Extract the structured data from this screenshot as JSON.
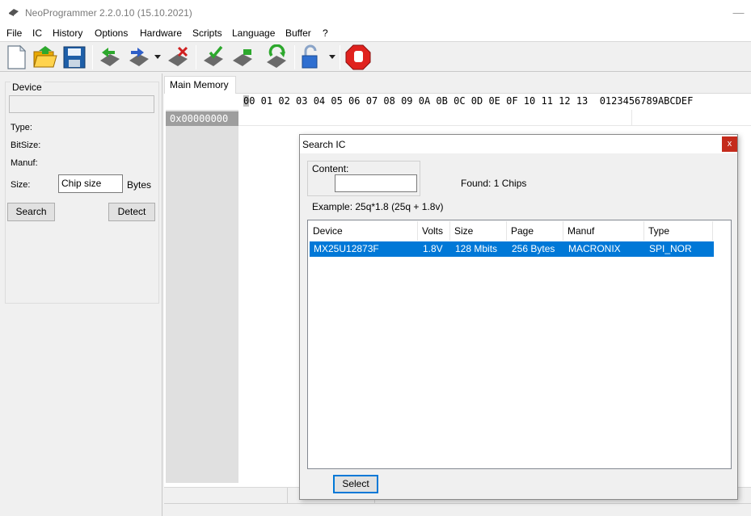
{
  "window": {
    "title": "NeoProgrammer 2.2.0.10 (15.10.2021)",
    "minimize_glyph": "—"
  },
  "menu": [
    "File",
    "IC",
    "History",
    "Options",
    "Hardware",
    "Scripts",
    "Language",
    "Buffer",
    "?"
  ],
  "toolbar": {
    "icons": [
      "new-file-icon",
      "open-folder-icon",
      "save-icon",
      "read-chip-icon",
      "write-chip-icon",
      "erase-chip-icon",
      "verify-chip-icon",
      "blank-check-icon",
      "auto-program-icon",
      "protect-lock-icon",
      "stop-icon"
    ]
  },
  "device_panel": {
    "legend": "Device",
    "type_label": "Type:",
    "bitsize_label": "BitSize:",
    "manuf_label": "Manuf:",
    "size_label": "Size:",
    "size_value": "Chip size",
    "bytes_label": "Bytes",
    "search_button": "Search",
    "detect_button": "Detect"
  },
  "memory": {
    "tab_label": "Main Memory",
    "hex_header_first": "0",
    "hex_header_rest": "0 01 02 03 04 05 06 07 08 09 0A 0B 0C 0D 0E 0F 10 11 12 13  0123456789ABCDEF",
    "address": "0x00000000"
  },
  "dialog": {
    "title": "Search IC",
    "close_glyph": "x",
    "content_legend": "Content:",
    "content_value": "",
    "found_text": "Found: 1  Chips",
    "example_text": "Example:  25q*1.8 (25q + 1.8v)",
    "columns": [
      "Device",
      "Volts",
      "Size",
      "Page",
      "Manuf",
      "Type"
    ],
    "rows": [
      {
        "device": "MX25U12873F",
        "volts": "1.8V",
        "size": "128 Mbits",
        "page": "256 Bytes",
        "manuf": "MACRONIX",
        "type": "SPI_NOR"
      }
    ],
    "select_button": "Select"
  },
  "colors": {
    "selection": "#0078d7",
    "close_red": "#c42b1c",
    "address_bg": "#9e9e9e"
  }
}
